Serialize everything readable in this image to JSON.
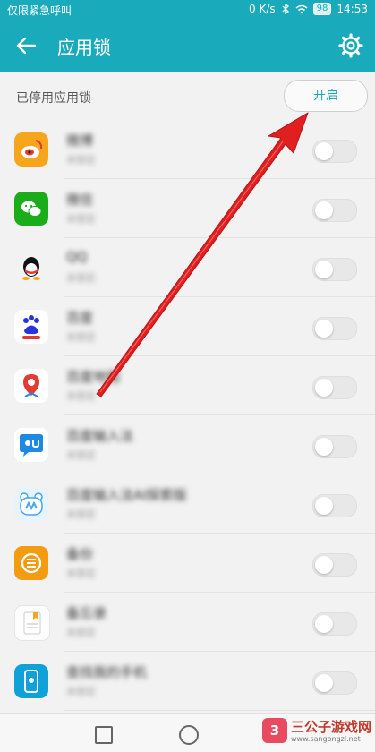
{
  "status_bar": {
    "carrier": "仅限紧急呼叫",
    "speed": "0 K/s",
    "battery": "98",
    "time": "14:53"
  },
  "header": {
    "title": "应用锁"
  },
  "section": {
    "label": "已停用应用锁",
    "open_button": "开启"
  },
  "apps": [
    {
      "name": "微博",
      "status": "未锁定",
      "icon": "weibo-icon",
      "color": "#f7a51c"
    },
    {
      "name": "微信",
      "status": "未锁定",
      "icon": "wechat-icon",
      "color": "#1aad19"
    },
    {
      "name": "QQ",
      "status": "未锁定",
      "icon": "qq-icon",
      "color": "#111111"
    },
    {
      "name": "百度",
      "status": "未锁定",
      "icon": "baidu-icon",
      "color": "#2932e1"
    },
    {
      "name": "百度地图",
      "status": "未锁定",
      "icon": "baidu-map-icon",
      "color": "#e53935"
    },
    {
      "name": "百度输入法",
      "status": "未锁定",
      "icon": "baidu-input-icon",
      "color": "#1e88e5"
    },
    {
      "name": "百度输入法AI探索版",
      "status": "未锁定",
      "icon": "baidu-ai-input-icon",
      "color": "#42a5f5"
    },
    {
      "name": "备份",
      "status": "未锁定",
      "icon": "backup-icon",
      "color": "#f39c12"
    },
    {
      "name": "备忘录",
      "status": "未锁定",
      "icon": "memo-icon",
      "color": "#f5a623"
    },
    {
      "name": "查找我的手机",
      "status": "未锁定",
      "icon": "find-phone-icon",
      "color": "#0fa1d8"
    }
  ],
  "watermark": {
    "title": "三公子游戏网",
    "url": "www.sangongzi.net"
  },
  "colors": {
    "accent": "#19aabb",
    "arrow": "#e02020"
  }
}
